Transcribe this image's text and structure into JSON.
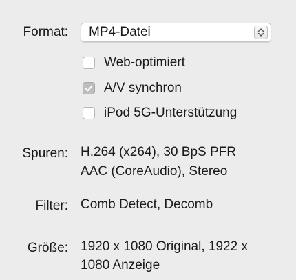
{
  "format": {
    "label": "Format:",
    "selected": "MP4-Datei",
    "options": {
      "web_optimized": {
        "label": "Web-optimiert",
        "checked": false
      },
      "av_sync": {
        "label": "A/V synchron",
        "checked": true
      },
      "ipod": {
        "label": "iPod 5G-Unterstützung",
        "checked": false
      }
    }
  },
  "tracks": {
    "label": "Spuren:",
    "line1": "H.264 (x264), 30 BpS PFR",
    "line2": "AAC (CoreAudio), Stereo"
  },
  "filters": {
    "label": "Filter:",
    "value": "Comb Detect, Decomb"
  },
  "size": {
    "label": "Größe:",
    "line1": "1920 x 1080 Original, 1922 x",
    "line2": "1080 Anzeige"
  }
}
